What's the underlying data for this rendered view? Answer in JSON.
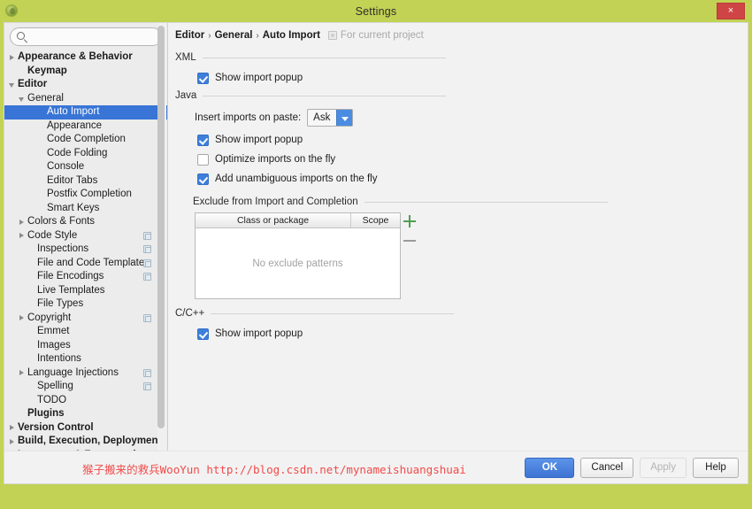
{
  "window": {
    "title": "Settings",
    "close_label": "×",
    "app_icon": "intellij-app-icon"
  },
  "sidebar": {
    "search": {
      "value": "",
      "placeholder": ""
    },
    "items": [
      {
        "label": "Appearance & Behavior",
        "indent": 0,
        "arrow": "right",
        "bold": true,
        "selected": false,
        "badge": false
      },
      {
        "label": "Keymap",
        "indent": 1,
        "arrow": "none",
        "bold": true,
        "selected": false,
        "badge": false
      },
      {
        "label": "Editor",
        "indent": 0,
        "arrow": "down",
        "bold": true,
        "selected": false,
        "badge": false
      },
      {
        "label": "General",
        "indent": 1,
        "arrow": "down",
        "bold": false,
        "selected": false,
        "badge": false
      },
      {
        "label": "Auto Import",
        "indent": 3,
        "arrow": "none",
        "bold": false,
        "selected": true,
        "badge": false
      },
      {
        "label": "Appearance",
        "indent": 3,
        "arrow": "none",
        "bold": false,
        "selected": false,
        "badge": false
      },
      {
        "label": "Code Completion",
        "indent": 3,
        "arrow": "none",
        "bold": false,
        "selected": false,
        "badge": false
      },
      {
        "label": "Code Folding",
        "indent": 3,
        "arrow": "none",
        "bold": false,
        "selected": false,
        "badge": false
      },
      {
        "label": "Console",
        "indent": 3,
        "arrow": "none",
        "bold": false,
        "selected": false,
        "badge": false
      },
      {
        "label": "Editor Tabs",
        "indent": 3,
        "arrow": "none",
        "bold": false,
        "selected": false,
        "badge": false
      },
      {
        "label": "Postfix Completion",
        "indent": 3,
        "arrow": "none",
        "bold": false,
        "selected": false,
        "badge": false
      },
      {
        "label": "Smart Keys",
        "indent": 3,
        "arrow": "none",
        "bold": false,
        "selected": false,
        "badge": false
      },
      {
        "label": "Colors & Fonts",
        "indent": 1,
        "arrow": "right",
        "bold": false,
        "selected": false,
        "badge": false
      },
      {
        "label": "Code Style",
        "indent": 1,
        "arrow": "right",
        "bold": false,
        "selected": false,
        "badge": true
      },
      {
        "label": "Inspections",
        "indent": 2,
        "arrow": "none",
        "bold": false,
        "selected": false,
        "badge": true
      },
      {
        "label": "File and Code Templates",
        "indent": 2,
        "arrow": "none",
        "bold": false,
        "selected": false,
        "badge": true
      },
      {
        "label": "File Encodings",
        "indent": 2,
        "arrow": "none",
        "bold": false,
        "selected": false,
        "badge": true
      },
      {
        "label": "Live Templates",
        "indent": 2,
        "arrow": "none",
        "bold": false,
        "selected": false,
        "badge": false
      },
      {
        "label": "File Types",
        "indent": 2,
        "arrow": "none",
        "bold": false,
        "selected": false,
        "badge": false
      },
      {
        "label": "Copyright",
        "indent": 1,
        "arrow": "right",
        "bold": false,
        "selected": false,
        "badge": true
      },
      {
        "label": "Emmet",
        "indent": 2,
        "arrow": "none",
        "bold": false,
        "selected": false,
        "badge": false
      },
      {
        "label": "Images",
        "indent": 2,
        "arrow": "none",
        "bold": false,
        "selected": false,
        "badge": false
      },
      {
        "label": "Intentions",
        "indent": 2,
        "arrow": "none",
        "bold": false,
        "selected": false,
        "badge": false
      },
      {
        "label": "Language Injections",
        "indent": 1,
        "arrow": "right",
        "bold": false,
        "selected": false,
        "badge": true
      },
      {
        "label": "Spelling",
        "indent": 2,
        "arrow": "none",
        "bold": false,
        "selected": false,
        "badge": true
      },
      {
        "label": "TODO",
        "indent": 2,
        "arrow": "none",
        "bold": false,
        "selected": false,
        "badge": false
      },
      {
        "label": "Plugins",
        "indent": 1,
        "arrow": "none",
        "bold": true,
        "selected": false,
        "badge": false
      },
      {
        "label": "Version Control",
        "indent": 0,
        "arrow": "right",
        "bold": true,
        "selected": false,
        "badge": false
      },
      {
        "label": "Build, Execution, Deployment",
        "indent": 0,
        "arrow": "right",
        "bold": true,
        "selected": false,
        "badge": false
      },
      {
        "label": "Languages & Frameworks",
        "indent": 0,
        "arrow": "right",
        "bold": true,
        "selected": false,
        "badge": false
      }
    ]
  },
  "main": {
    "breadcrumb": [
      "Editor",
      "General",
      "Auto Import"
    ],
    "breadcrumb_separator": "›",
    "scope_label": "For current project",
    "groups": {
      "xml": {
        "title": "XML",
        "show_import_popup": {
          "label": "Show import popup",
          "checked": true
        }
      },
      "java": {
        "title": "Java",
        "insert_imports_label": "Insert imports on paste:",
        "insert_imports_value": "Ask",
        "checks": [
          {
            "label": "Show import popup",
            "checked": true
          },
          {
            "label": "Optimize imports on the fly",
            "checked": false
          },
          {
            "label": "Add unambiguous imports on the fly",
            "checked": true
          }
        ]
      },
      "exclude": {
        "title": "Exclude from Import and Completion",
        "columns": [
          "Class or package",
          "Scope"
        ],
        "empty_text": "No exclude patterns",
        "add_button": "+",
        "remove_button": "−"
      },
      "cpp": {
        "title": "C/C++",
        "show_import_popup": {
          "label": "Show import popup",
          "checked": true
        }
      }
    }
  },
  "watermark": {
    "text": "猴子搬来的救兵WooYun http://blog.csdn.net/mynameishuangshuai",
    "color": "#f24a4a"
  },
  "footer": {
    "ok": "OK",
    "cancel": "Cancel",
    "apply": "Apply",
    "help": "Help"
  }
}
